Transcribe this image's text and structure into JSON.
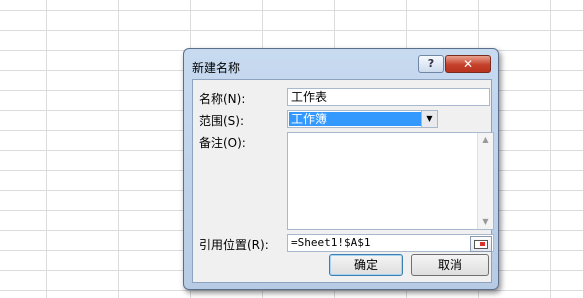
{
  "dialog": {
    "title": "新建名称",
    "help_glyph": "?",
    "close_glyph": "✕",
    "name_label": "名称(N):",
    "name_value": "工作表",
    "scope_label": "范围(S):",
    "scope_value": "工作簿",
    "comment_label": "备注(O):",
    "comment_value": "",
    "refers_label": "引用位置(R):",
    "refers_value": "=Sheet1!$A$1",
    "ok_label": "确定",
    "cancel_label": "取消"
  },
  "icons": {
    "dropdown": "chevron-down-icon",
    "scroll_up": "scroll-up-icon",
    "scroll_down": "scroll-down-icon",
    "range_picker": "range-select-icon"
  }
}
